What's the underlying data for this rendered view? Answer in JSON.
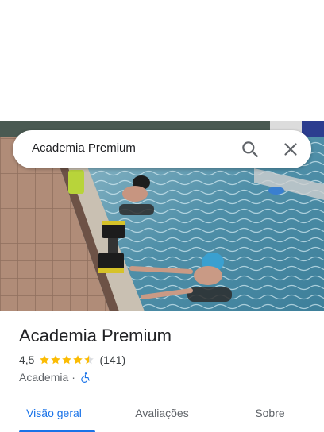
{
  "search": {
    "query": "Academia Premium"
  },
  "place": {
    "name": "Academia Premium",
    "rating": "4,5",
    "rating_value": 4.5,
    "review_count": "(141)",
    "category": "Academia",
    "separator": "·"
  },
  "tabs": [
    {
      "label": "Visão geral",
      "active": true
    },
    {
      "label": "Avaliações",
      "active": false
    },
    {
      "label": "Sobre",
      "active": false
    }
  ],
  "icons": {
    "search": "search-icon",
    "close": "close-icon",
    "star": "star-icon",
    "accessibility": "wheelchair-icon"
  },
  "colors": {
    "accent": "#1a73e8",
    "star": "#fbbc04",
    "title": "#202124",
    "muted": "#5f6368"
  }
}
